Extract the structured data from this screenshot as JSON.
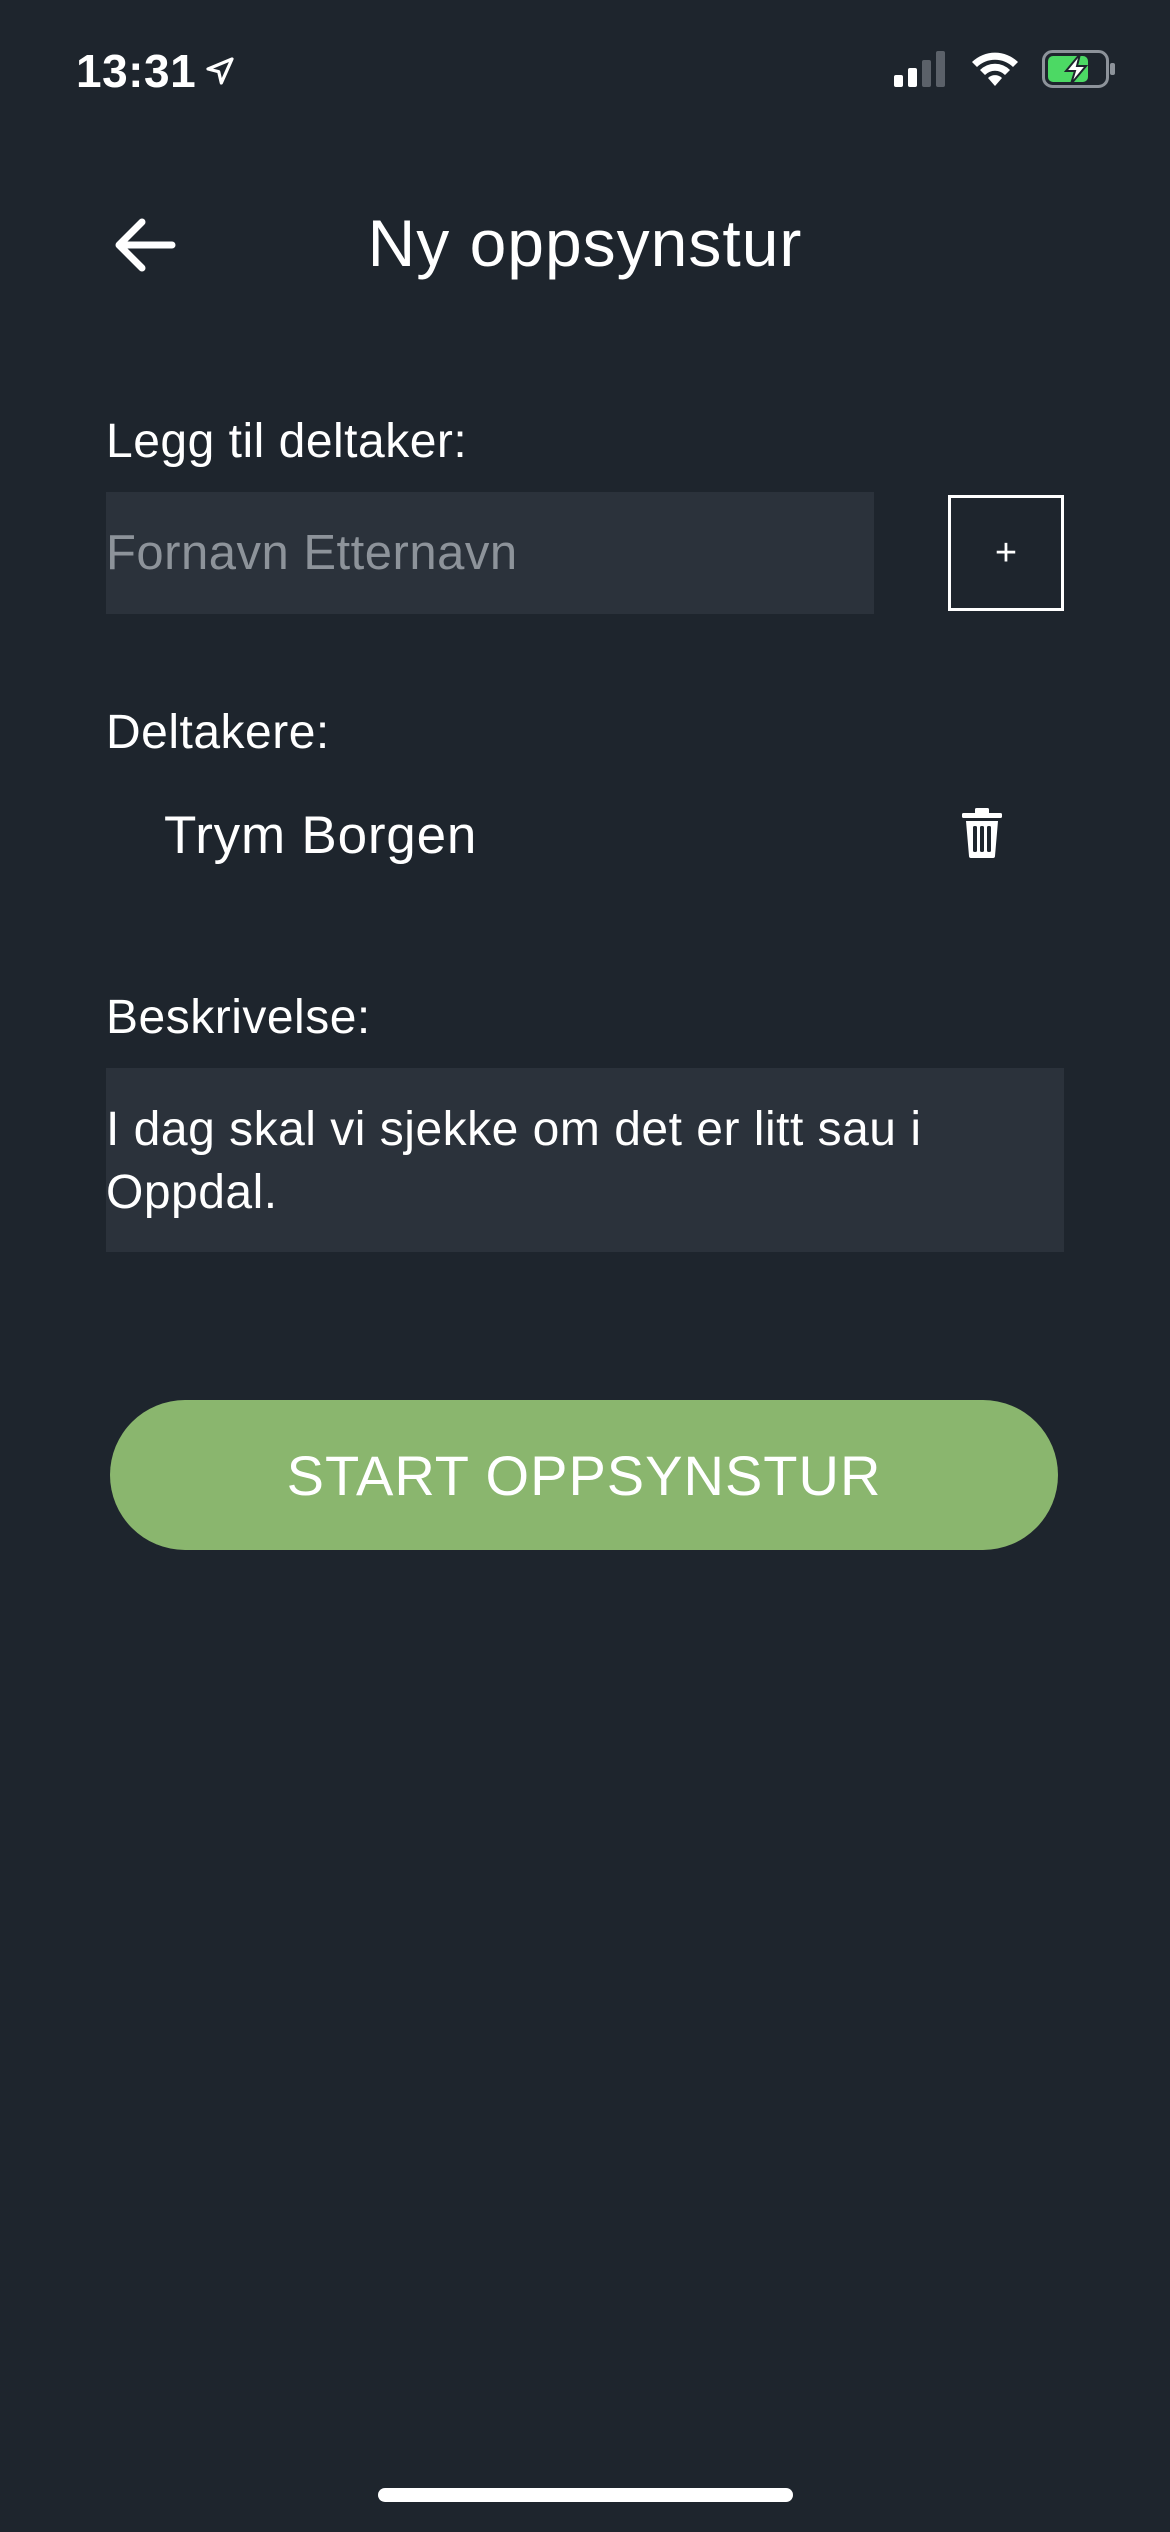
{
  "status_bar": {
    "time": "13:31",
    "icons": [
      "location-arrow-icon",
      "cellular-signal-icon",
      "wifi-icon",
      "battery-charging-icon"
    ],
    "battery_color": "#4cd964"
  },
  "header": {
    "back_icon": "arrow-left-icon",
    "title": "Ny oppsynstur"
  },
  "add_participant": {
    "label": "Legg til deltaker:",
    "input_placeholder": "Fornavn Etternavn",
    "input_value": "",
    "add_button_label": "+"
  },
  "participants": {
    "label": "Deltakere:",
    "items": [
      {
        "name": "Trym Borgen",
        "delete_icon": "trash-icon"
      }
    ]
  },
  "description": {
    "label": "Beskrivelse:",
    "value": "I dag skal vi sjekke om det er litt sau i Oppdal."
  },
  "start_button": {
    "label": "START OPPSYNSTUR",
    "color": "#8ab66e"
  },
  "colors": {
    "background": "#1e252d",
    "input_background": "#2b323b",
    "text": "#ffffff",
    "placeholder": "#8d939a"
  }
}
